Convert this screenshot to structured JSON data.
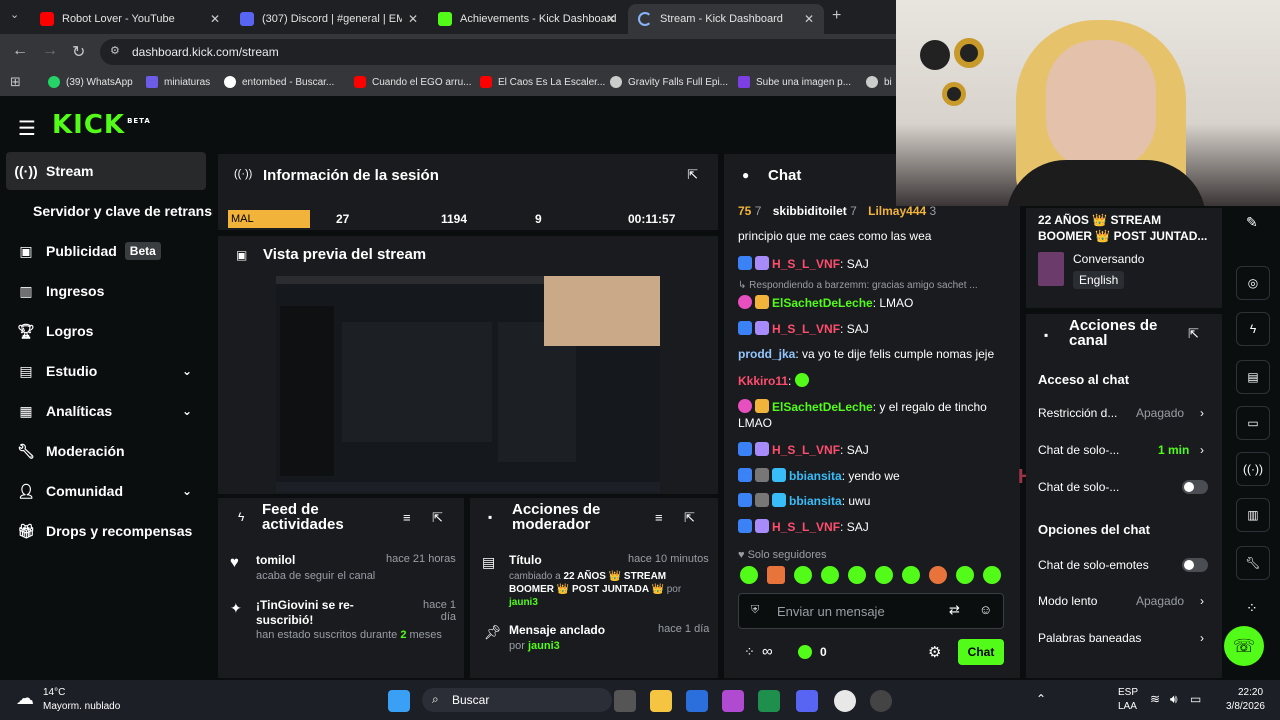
{
  "browser": {
    "tabs": [
      {
        "title": "Robot Lover - YouTube"
      },
      {
        "title": "(307) Discord | #general | EMO"
      },
      {
        "title": "Achievements - Kick Dashboard"
      },
      {
        "title": "Stream - Kick Dashboard"
      }
    ],
    "url": "dashboard.kick.com/stream",
    "bookmarks": [
      "(39) WhatsApp",
      "miniaturas",
      "entombed - Buscar...",
      "Cuando el EGO arru...",
      "El Caos Es La Escaler...",
      "Gravity Falls Full Epi...",
      "Sube una imagen p...",
      "bi"
    ]
  },
  "brand": {
    "logo": "KICK",
    "beta": "BETA",
    "accent": "#53fc18"
  },
  "sidebar": {
    "items": [
      {
        "label": "Stream"
      },
      {
        "label": "Servidor y clave de retransmisión"
      },
      {
        "label": "Publicidad",
        "badge": "Beta"
      },
      {
        "label": "Ingresos"
      },
      {
        "label": "Logros"
      },
      {
        "label": "Estudio"
      },
      {
        "label": "Analíticas"
      },
      {
        "label": "Moderación"
      },
      {
        "label": "Comunidad"
      },
      {
        "label": "Drops y recompensas"
      }
    ]
  },
  "session": {
    "title": "Información de la sesión",
    "stats": [
      "MAL",
      "27",
      "1194",
      "9",
      "00:11:57"
    ]
  },
  "preview": {
    "title": "Vista previa del stream"
  },
  "feed": {
    "title": "Feed de actividades",
    "items": [
      {
        "name": "tomilol",
        "time": "hace 21 horas",
        "desc": "acaba de seguir el canal"
      },
      {
        "name": "¡TinGiovini se re-suscribió!",
        "time": "hace 1 día",
        "desc": "han estado suscritos durante",
        "months": "2",
        "suffix": "meses"
      }
    ]
  },
  "mod": {
    "title": "Acciones de moderador",
    "items": [
      {
        "label": "Título",
        "time": "hace 10 minutos",
        "desc": "cambiado a",
        "value": "22 AÑOS 👑 STREAM BOOMER 👑 POST JUNTADA 👑",
        "by": "por",
        "user": "jauni3"
      },
      {
        "label": "Mensaje anclado",
        "time": "hace 1 día",
        "by": "por",
        "user": "jauni3"
      }
    ]
  },
  "chat": {
    "title": "Chat",
    "top": {
      "count": "75",
      "c2": "7",
      "user1": "skibbiditoilet",
      "c3": "7",
      "user2": "Lilmay444",
      "c4": "3"
    },
    "lines": [
      {
        "text": "principio que me caes como las wea"
      },
      {
        "user": "H_S_L_VNF",
        "text": ": SAJ"
      },
      {
        "reply": "Respondiendo a barzemm: gracias amigo sachet ..."
      },
      {
        "user": "ElSachetDeLeche",
        "text": ": LMAO"
      },
      {
        "user": "H_S_L_VNF",
        "text": ": SAJ"
      },
      {
        "user": "prodd_jka",
        "text": ": va yo te dije felis cumple nomas jeje"
      },
      {
        "user": "Kkkiro11",
        "text": ":"
      },
      {
        "user": "ElSachetDeLeche",
        "text": ": y el regalo de tincho"
      },
      {
        "text": "LMAO"
      },
      {
        "user": "H_S_L_VNF",
        "text": ": SAJ"
      },
      {
        "user": "bbiansita",
        "text": ": yendo we"
      },
      {
        "user": "bbiansita",
        "text": ": uwu"
      },
      {
        "user": "H_S_L_VNF",
        "text": ": SAJ"
      }
    ],
    "followers_only": "Solo seguidores",
    "placeholder": "Enviar un mensaje",
    "kick_count": "0",
    "send": "Chat",
    "overlay": "H_S"
  },
  "right": {
    "stream_title": "22 AÑOS 👑 STREAM BOOMER 👑 POST JUNTAD...",
    "category": "Conversando",
    "language": "English",
    "actions_title": "Acciones de canal",
    "access": "Acceso al chat",
    "rows": [
      {
        "label": "Restricción d...",
        "value": "Apagado"
      },
      {
        "label": "Chat de solo-...",
        "value": "1 min"
      },
      {
        "label": "Chat de solo-..."
      }
    ],
    "options": "Opciones del chat",
    "opts": [
      {
        "label": "Chat de solo-emotes"
      },
      {
        "label": "Modo lento",
        "value": "Apagado"
      },
      {
        "label": "Palabras baneadas"
      }
    ]
  },
  "taskbar": {
    "temp": "14°C",
    "weather": "Mayorm. nublado",
    "search": "Buscar",
    "lang": "ESP",
    "region": "LAA",
    "time": "22:20",
    "date": "3/8/2026"
  }
}
